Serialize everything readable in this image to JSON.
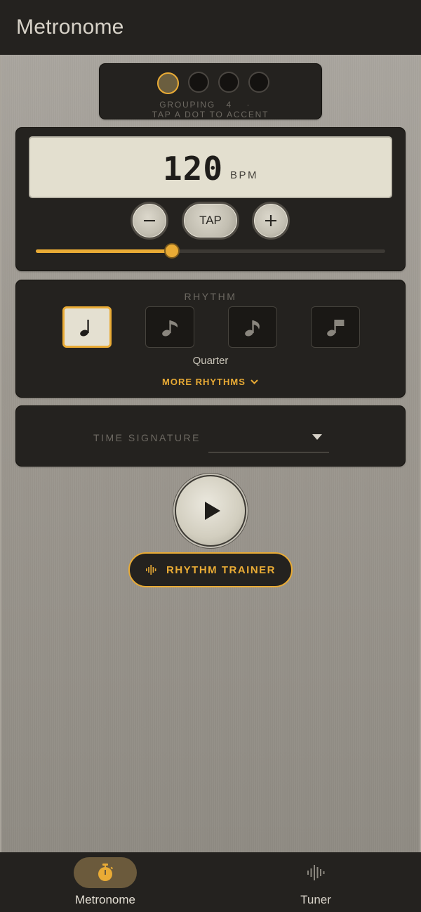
{
  "app_bar": {
    "title": "Metronome"
  },
  "grouping": {
    "dots": [
      {
        "accented": true
      },
      {
        "accented": false
      },
      {
        "accented": false
      },
      {
        "accented": false
      }
    ],
    "label": "GROUPING",
    "count": "4",
    "separator": "·",
    "hint": "TAP A DOT TO ACCENT"
  },
  "tempo": {
    "bpm": "120",
    "unit": "BPM",
    "minus_icon": "minus-icon",
    "plus_icon": "plus-icon",
    "tap_label": "TAP",
    "slider_fraction": 0.39
  },
  "rhythm": {
    "section_label": "RHYTHM",
    "options": [
      {
        "icon": "quarter-note-icon",
        "selected": true
      },
      {
        "icon": "eighth-notes-icon",
        "selected": false
      },
      {
        "icon": "triplet-notes-icon",
        "selected": false
      },
      {
        "icon": "sixteenth-notes-icon",
        "selected": false
      }
    ],
    "selected_name": "Quarter",
    "more_label": "MORE RHYTHMS"
  },
  "time_signature": {
    "label": "TIME SIGNATURE",
    "value": ""
  },
  "play": {
    "icon": "play-icon"
  },
  "rhythm_trainer": {
    "label": "RHYTHM TRAINER",
    "icon": "waveform-icon"
  },
  "bottom_nav": {
    "items": [
      {
        "label": "Metronome",
        "icon": "stopwatch-icon",
        "active": true
      },
      {
        "label": "Tuner",
        "icon": "waveform-icon",
        "active": false
      }
    ]
  },
  "colors": {
    "accent": "#e9ab35",
    "panel": "#24221f",
    "lcd": "#e3dfcf"
  }
}
